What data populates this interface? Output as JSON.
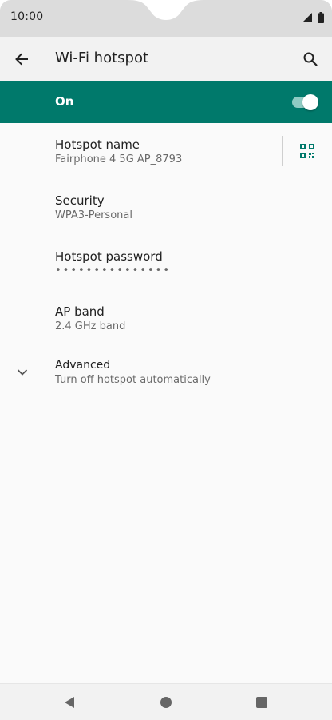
{
  "status_bar": {
    "time": "10:00"
  },
  "app_bar": {
    "title": "Wi-Fi hotspot"
  },
  "master_switch": {
    "label": "On",
    "state": true
  },
  "settings": [
    {
      "title": "Hotspot name",
      "summary": "Fairphone 4 5G AP_8793"
    },
    {
      "title": "Security",
      "summary": "WPA3-Personal"
    },
    {
      "title": "Hotspot password",
      "summary": "•••••••••••••••"
    },
    {
      "title": "AP band",
      "summary": "2.4 GHz band"
    },
    {
      "title": "Advanced",
      "summary": "Turn off hotspot automatically"
    }
  ],
  "colors": {
    "accent": "#00796b",
    "status_bar": "#dcdcdc",
    "background": "#fafafa"
  },
  "icons": {
    "back": "arrow-back-icon",
    "search": "search-icon",
    "qr": "qr-code-icon",
    "expand": "chevron-down-icon",
    "nav_back": "triangle-back-icon",
    "nav_home": "circle-home-icon",
    "nav_recents": "square-recents-icon"
  }
}
